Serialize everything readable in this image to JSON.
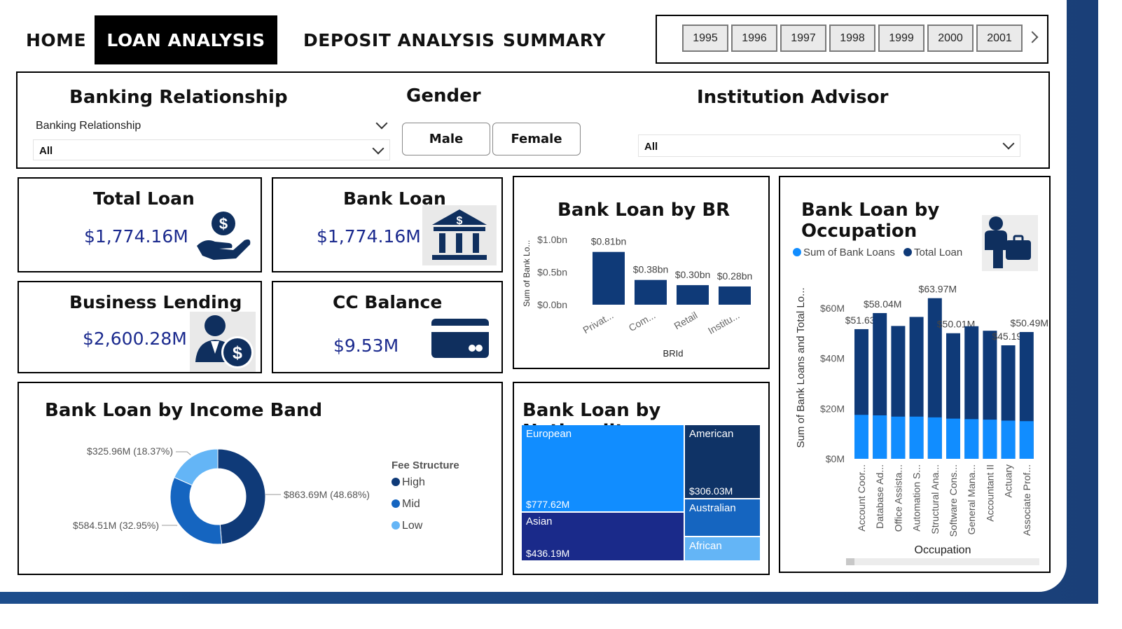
{
  "nav": {
    "tabs": [
      {
        "label": "HOME"
      },
      {
        "label": "LOAN ANALYSIS",
        "active": true
      },
      {
        "label": "DEPOSIT ANALYSIS"
      },
      {
        "label": "SUMMARY"
      }
    ],
    "years": [
      "1995",
      "1996",
      "1997",
      "1998",
      "1999",
      "2000",
      "2001"
    ]
  },
  "filters": {
    "banking_relationship": {
      "title": "Banking Relationship",
      "label": "Banking Relationship",
      "value": "All"
    },
    "gender": {
      "title": "Gender",
      "options": [
        "Male",
        "Female"
      ]
    },
    "institution_advisor": {
      "title": "Institution Advisor",
      "value": "All"
    }
  },
  "kpis": {
    "total_loan": {
      "title": "Total Loan",
      "value": "$1,774.16M",
      "icon": "hand-dollar-icon"
    },
    "bank_loan": {
      "title": "Bank Loan",
      "value": "$1,774.16M",
      "icon": "bank-building-icon"
    },
    "business_lending": {
      "title": "Business Lending",
      "value": "$2,600.28M",
      "icon": "businessman-dollar-icon"
    },
    "cc_balance": {
      "title": "CC Balance",
      "value": "$9.53M",
      "icon": "credit-card-icon"
    }
  },
  "colors": {
    "dark": "#0f3a78",
    "mid": "#1565c0",
    "light": "#64b5f6",
    "bright": "#118dff",
    "navy": "#1a2a8a"
  },
  "chart_data": [
    {
      "id": "br",
      "type": "bar",
      "title": "Bank Loan by BR",
      "xlabel": "BRId",
      "ylabel": "Sum of Bank Lo...",
      "categories": [
        "Privat...",
        "Com...",
        "Retail",
        "Institu..."
      ],
      "values": [
        0.81,
        0.38,
        0.3,
        0.28
      ],
      "labels": [
        "$0.81bn",
        "$0.38bn",
        "$0.30bn",
        "$0.28bn"
      ],
      "yticks": [
        "$0.0bn",
        "$0.5bn",
        "$1.0bn"
      ],
      "ylim": [
        0,
        1.0
      ]
    },
    {
      "id": "occupation",
      "type": "bar",
      "title": "Bank Loan by Occupation",
      "xlabel": "Occupation",
      "ylabel": "Sum of Bank Loans and Total Lo...",
      "legend": [
        "Sum of Bank Loans",
        "Total Loan"
      ],
      "categories": [
        "Account Coor...",
        "Database Ad...",
        "Office Assista...",
        "Automation S...",
        "Structural Ana...",
        "Software Cons...",
        "General Mana...",
        "Accountant II",
        "Actuary",
        "Associate Prof..."
      ],
      "series": [
        {
          "name": "Sum of Bank Loans",
          "values": [
            17.5,
            17.3,
            16.8,
            16.8,
            16.5,
            16.0,
            15.8,
            15.6,
            15.2,
            15.0
          ]
        },
        {
          "name": "Total Loan",
          "values": [
            51.63,
            58.04,
            52.9,
            56.5,
            63.97,
            50.01,
            52.8,
            51.0,
            45.19,
            50.49
          ]
        }
      ],
      "labels": {
        "0": "$51.63M",
        "1": "$58.04M",
        "4": "$63.97M",
        "5": "$50.01M",
        "8": "$45.19M",
        "9": "$50.49M"
      },
      "yticks": [
        "$0M",
        "$20M",
        "$40M",
        "$60M"
      ],
      "ylim": [
        0,
        65
      ]
    },
    {
      "id": "income",
      "type": "pie",
      "title": "Bank Loan by Income Band",
      "legend_title": "Fee Structure",
      "slices": [
        {
          "name": "High",
          "value": 863.69,
          "label": "$863.69M (48.68%)"
        },
        {
          "name": "Mid",
          "value": 584.51,
          "label": "$584.51M (32.95%)"
        },
        {
          "name": "Low",
          "value": 325.96,
          "label": "$325.96M (18.37%)"
        }
      ]
    },
    {
      "id": "nationality",
      "type": "heatmap",
      "title": "Bank Loan by Nationality",
      "items": [
        {
          "name": "European",
          "value": "$777.62M"
        },
        {
          "name": "American",
          "value": "$306.03M"
        },
        {
          "name": "Asian",
          "value": "$436.19M"
        },
        {
          "name": "Australian",
          "value": ""
        },
        {
          "name": "African",
          "value": ""
        }
      ]
    }
  ]
}
